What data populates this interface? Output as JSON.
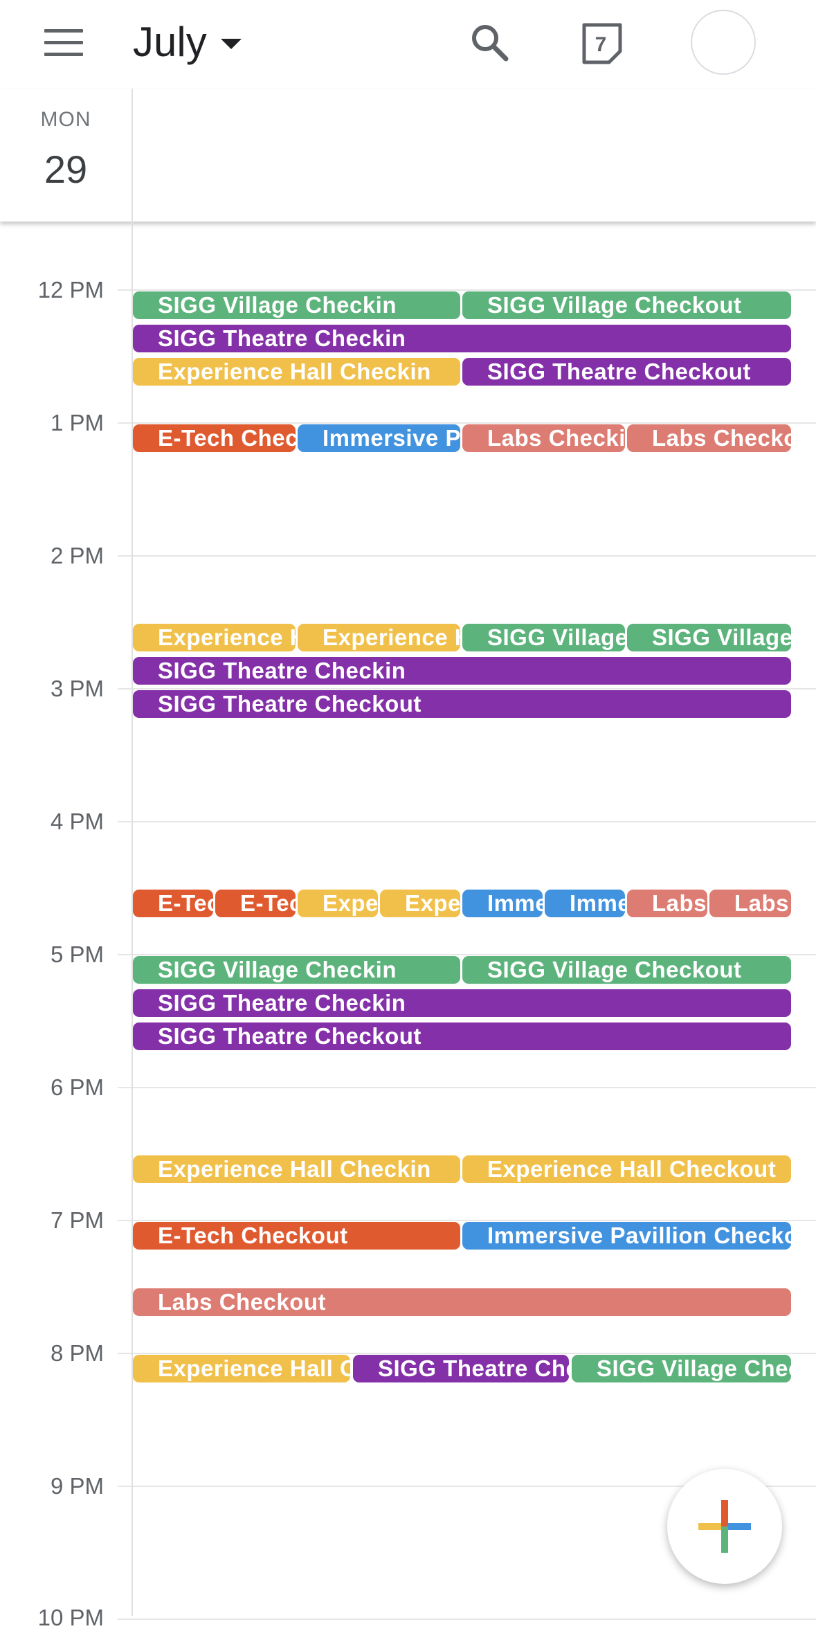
{
  "header": {
    "month": "July",
    "today_badge": "7"
  },
  "day": {
    "dow": "MON",
    "date": "29"
  },
  "hours": [
    "12 PM",
    "1 PM",
    "2 PM",
    "3 PM",
    "4 PM",
    "5 PM",
    "6 PM",
    "7 PM",
    "8 PM",
    "9 PM",
    "10 PM"
  ],
  "events": [
    "SIGG Village Checkin",
    "SIGG Village Checkout",
    "SIGG Theatre Checkin",
    "Experience Hall Checkin",
    "SIGG Theatre Checkout",
    "E-Tech Checkin",
    "Immersive Pavillion Checkin",
    "Labs Checkin",
    "Labs Checkout",
    "Experience Hall Checkin",
    "Experience Hall Checkout",
    "SIGG Village Checkin",
    "SIGG Village Checkout",
    "SIGG Theatre Checkin",
    "SIGG Theatre Checkout",
    "E-Tech Checkin",
    "E-Tech Checkout",
    "Experience Hall Checkin",
    "Experience Hall Checkout",
    "Immersive Pavillion Checkin",
    "Immersive Pavillion Checkout",
    "Labs Checkin",
    "Labs Checkout",
    "SIGG Village Checkin",
    "SIGG Village Checkout",
    "SIGG Theatre Checkin",
    "SIGG Theatre Checkout",
    "Experience Hall Checkin",
    "Experience Hall Checkout",
    "E-Tech Checkout",
    "Immersive Pavillion Checkout",
    "Labs Checkout",
    "Experience Hall Checkout",
    "SIGG Theatre Checkout",
    "SIGG Village Checkout"
  ],
  "colors": {
    "sigg_village": "#5cb37c",
    "sigg_theatre": "#8430a8",
    "experience_hall": "#f0c04a",
    "etech": "#e05a2f",
    "immersive_pavillion": "#4192df",
    "labs": "#dd7c72"
  },
  "icons": {
    "menu": "menu-icon",
    "search": "search-icon",
    "today": "calendar-today-icon",
    "fab": "add-plus-icon"
  }
}
